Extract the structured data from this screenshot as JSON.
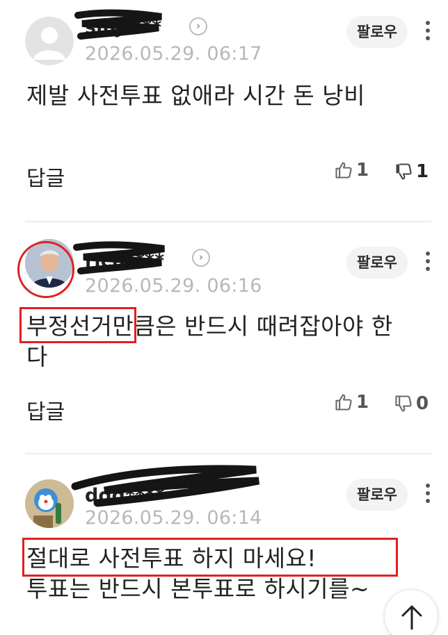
{
  "comments": [
    {
      "username": "sinj****",
      "timestamp": "2026.05.29. 06:17",
      "follow_label": "팔로우",
      "body": "제발 사전투표 없애라 시간 돈 낭비",
      "reply_label": "답글",
      "likes": "1",
      "dislikes": "1"
    },
    {
      "username": "rich****",
      "timestamp": "2026.05.29. 06:16",
      "follow_label": "팔로우",
      "body_highlight": "부정선거",
      "body_rest": "만큼은 반드시 때려잡아야 한다",
      "reply_label": "답글",
      "likes": "1",
      "dislikes": "0"
    },
    {
      "username": "ddd****",
      "timestamp": "2026.05.29. 06:14",
      "follow_label": "팔로우",
      "body_highlight": "절대로 사전투표 하지 마세요!",
      "body_rest": "투표는 반드시 본투표로 하시기를~"
    }
  ],
  "icons": {
    "profile_link": "chevron-right-icon",
    "more": "more-vertical-icon",
    "like": "thumbs-up-icon",
    "dislike": "thumbs-down-icon",
    "scroll_top": "arrow-up-icon"
  },
  "colors": {
    "annotation_red": "#e02020",
    "timestamp_gray": "#b8b8b8",
    "follow_bg": "#f3f3f3"
  }
}
